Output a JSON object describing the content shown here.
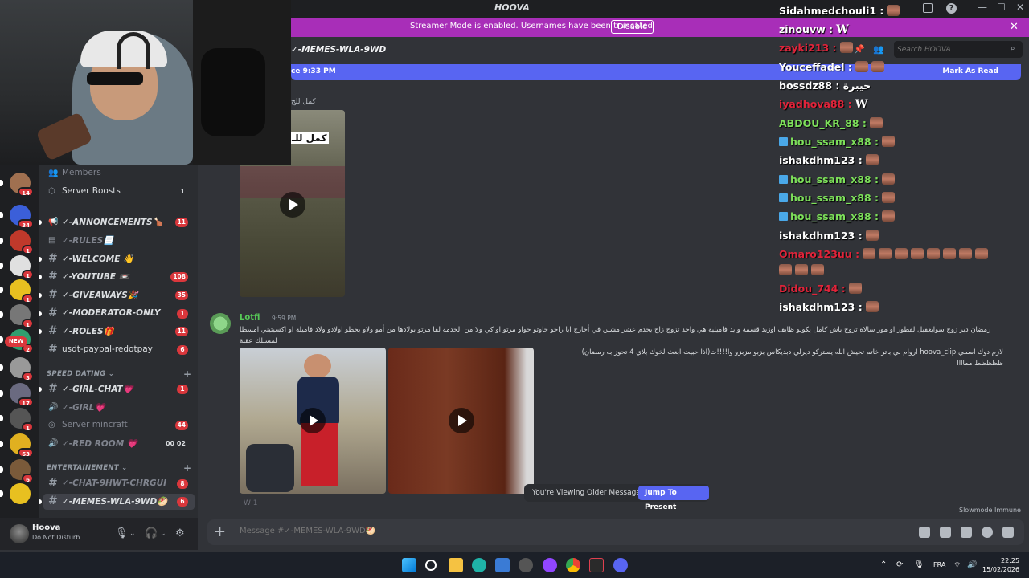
{
  "app": {
    "title": "HOOVA",
    "window_controls": [
      "—",
      "☐",
      "✕"
    ]
  },
  "banner": {
    "text": "Streamer Mode is enabled. Usernames have been truncated.",
    "button": "Disable",
    "close": "✕"
  },
  "channel_header": {
    "name": "✓-MEMES-WLA-9WD",
    "search_placeholder": "Search HOOVA"
  },
  "new_messages_bar": {
    "since": "ce 9:33 PM",
    "mark_as_read": "Mark As Read"
  },
  "servers": [
    {
      "badge": "14",
      "color": "#a07050"
    },
    {
      "badge": "34",
      "color": "#3b5fd9"
    },
    {
      "badge": "1",
      "color": "#c0392b"
    },
    {
      "badge": "1",
      "color": "#e0e0e0"
    },
    {
      "badge": "1",
      "color": "#e8c020"
    },
    {
      "badge": "1",
      "color": "#777777"
    },
    {
      "badge": "2",
      "color": "#2f9e6f"
    },
    {
      "badge": "3",
      "color": "#999999"
    },
    {
      "badge": "17",
      "color": "#6a6a80"
    },
    {
      "badge": "1",
      "color": "#555555"
    },
    {
      "badge": "63",
      "color": "#e0b020"
    },
    {
      "badge": "6",
      "color": "#7a5a3a"
    },
    {
      "badge": "",
      "color": "#e8c020"
    }
  ],
  "new_badge": "NEW",
  "sidebar": {
    "items": [
      {
        "icon": "👥",
        "label": "Members",
        "count": "",
        "style": "plain-dim"
      },
      {
        "icon": "⬡",
        "label": "Server Boosts",
        "count": "1",
        "style": "plain-gray"
      },
      {
        "icon": "📢",
        "label": "✓-ANNONCEMENTS🍗",
        "count": "11",
        "style": "bold"
      },
      {
        "icon": "▤",
        "label": "✓-RULES📃",
        "count": "",
        "style": "dim"
      },
      {
        "icon": "#",
        "label": "✓-WELCOME 👋",
        "count": "",
        "style": "bold"
      },
      {
        "icon": "#",
        "label": "✓-YOUTUBE 📼",
        "count": "108",
        "style": "bold"
      },
      {
        "icon": "#",
        "label": "✓-GIVEAWAYS🎉",
        "count": "35",
        "style": "bold"
      },
      {
        "icon": "#",
        "label": "✓-MODERATOR-ONLY",
        "count": "1",
        "style": "bold"
      },
      {
        "icon": "#",
        "label": "✓-ROLES🎁",
        "count": "11",
        "style": "bold"
      },
      {
        "icon": "#",
        "label": "usdt-paypal-redotpay",
        "count": "6",
        "style": "plain"
      }
    ],
    "category_speed": "SPEED DATING",
    "speed_items": [
      {
        "icon": "#",
        "label": "✓-GIRL-CHAT💗",
        "count": "1",
        "style": "bold"
      },
      {
        "icon": "🔊",
        "label": "✓-GIRL💗",
        "count": "",
        "style": "dim"
      },
      {
        "icon": "◎",
        "label": "Server mincraft",
        "count": "44",
        "style": "plain-dim"
      },
      {
        "icon": "🔊",
        "label": "✓-RED ROOM 💗",
        "count": "00 02",
        "style": "dim-gray"
      }
    ],
    "category_ent": "ENTERTAINEMENT",
    "ent_items": [
      {
        "icon": "#",
        "label": "✓-CHAT-9HWT-CHRGUI",
        "count": "8",
        "style": "dim"
      },
      {
        "icon": "#",
        "label": "✓-MEMES-WLA-9WD🥙",
        "count": "6",
        "style": "bold"
      }
    ]
  },
  "user": {
    "name": "Hoova",
    "status": "Do Not Disturb"
  },
  "messages": {
    "partial_caption": "كمل للخ",
    "video_overlay_text": "كمل للـ",
    "author": "Lotfi",
    "time": "9:59 PM",
    "text_line1": "رمضان دير زوج سوايعقبل لفطور او مور سالاة تروح باش كامل يكونو ظايف اوزيد قسمة وايد فاميلية هي واحد تزوج زاح يخدم عشر مشين في أخارج ايا راحو خاوتو حواو مرتو او كي ولا من الخدمة لقا مرتو بولادها من أمو ولاو يحطو اولادو ولاد فاميلة او اكسيتيني امسطا لمستلك عقبة",
    "text_line2": "لازم دوك اسمي hoova_clip اروام لي باتر خاتم تحيش الله يستركو ديرلي دبديكاس بزبو مزبزو وا!!!!ت(اذا حبيت ابعث لخوك بلاي 4 تحوز به رمضان) ظظظظظ مماااا",
    "reaction": "W 1"
  },
  "older_messages": {
    "text": "You're Viewing Older Messages",
    "button": "Jump To Present"
  },
  "slowmode": "Slowmode Immune",
  "composer": {
    "placeholder": "Message #✓-MEMES-WLA-9WD🥙"
  },
  "chat_overlay": [
    {
      "user": "Sidahmedchouli1 :",
      "color": "#ffffff",
      "emotes": "e1",
      "tw": false
    },
    {
      "user": "zinouvw :",
      "color": "#ffffff",
      "emotes": "W",
      "tw": false
    },
    {
      "user": "zayki213 :",
      "color": "#e0243a",
      "emotes": "e1",
      "tw": false
    },
    {
      "user": "Youceffadel :",
      "color": "#ffffff",
      "emotes": "e2",
      "tw": false
    },
    {
      "user": "bossdz88 : حيبرة",
      "color": "#ffffff",
      "emotes": "",
      "tw": false
    },
    {
      "user": "iyadhova88 :",
      "color": "#e0243a",
      "emotes": "W",
      "tw": false
    },
    {
      "user": "ABDOU_KR_88 :",
      "color": "#7de05a",
      "emotes": "e1",
      "tw": false
    },
    {
      "user": "hou_ssam_x88 :",
      "color": "#7de05a",
      "emotes": "e1",
      "tw": true
    },
    {
      "user": "ishakdhm123 :",
      "color": "#ffffff",
      "emotes": "e1",
      "tw": false
    },
    {
      "user": "hou_ssam_x88 :",
      "color": "#7de05a",
      "emotes": "e1",
      "tw": true
    },
    {
      "user": "hou_ssam_x88 :",
      "color": "#7de05a",
      "emotes": "e1",
      "tw": true
    },
    {
      "user": "hou_ssam_x88 :",
      "color": "#7de05a",
      "emotes": "e1",
      "tw": true
    },
    {
      "user": "ishakdhm123 :",
      "color": "#ffffff",
      "emotes": "e1",
      "tw": false
    },
    {
      "user": "Omaro123uu :",
      "color": "#e0243a",
      "emotes": "e8",
      "tw": false
    },
    {
      "user": "",
      "color": "#ffffff",
      "emotes": "e3",
      "tw": false
    },
    {
      "user": "Didou_744 :",
      "color": "#e0243a",
      "emotes": "e1",
      "tw": false
    },
    {
      "user": "ishakdhm123 :",
      "color": "#ffffff",
      "emotes": "e1",
      "tw": false
    }
  ],
  "taskbar": {
    "lang": "FRA",
    "time": "22:25",
    "date": "15/02/2026"
  },
  "colors": {
    "accent": "#5865f2",
    "banner": "#a82eb8",
    "badge": "#da373c"
  }
}
